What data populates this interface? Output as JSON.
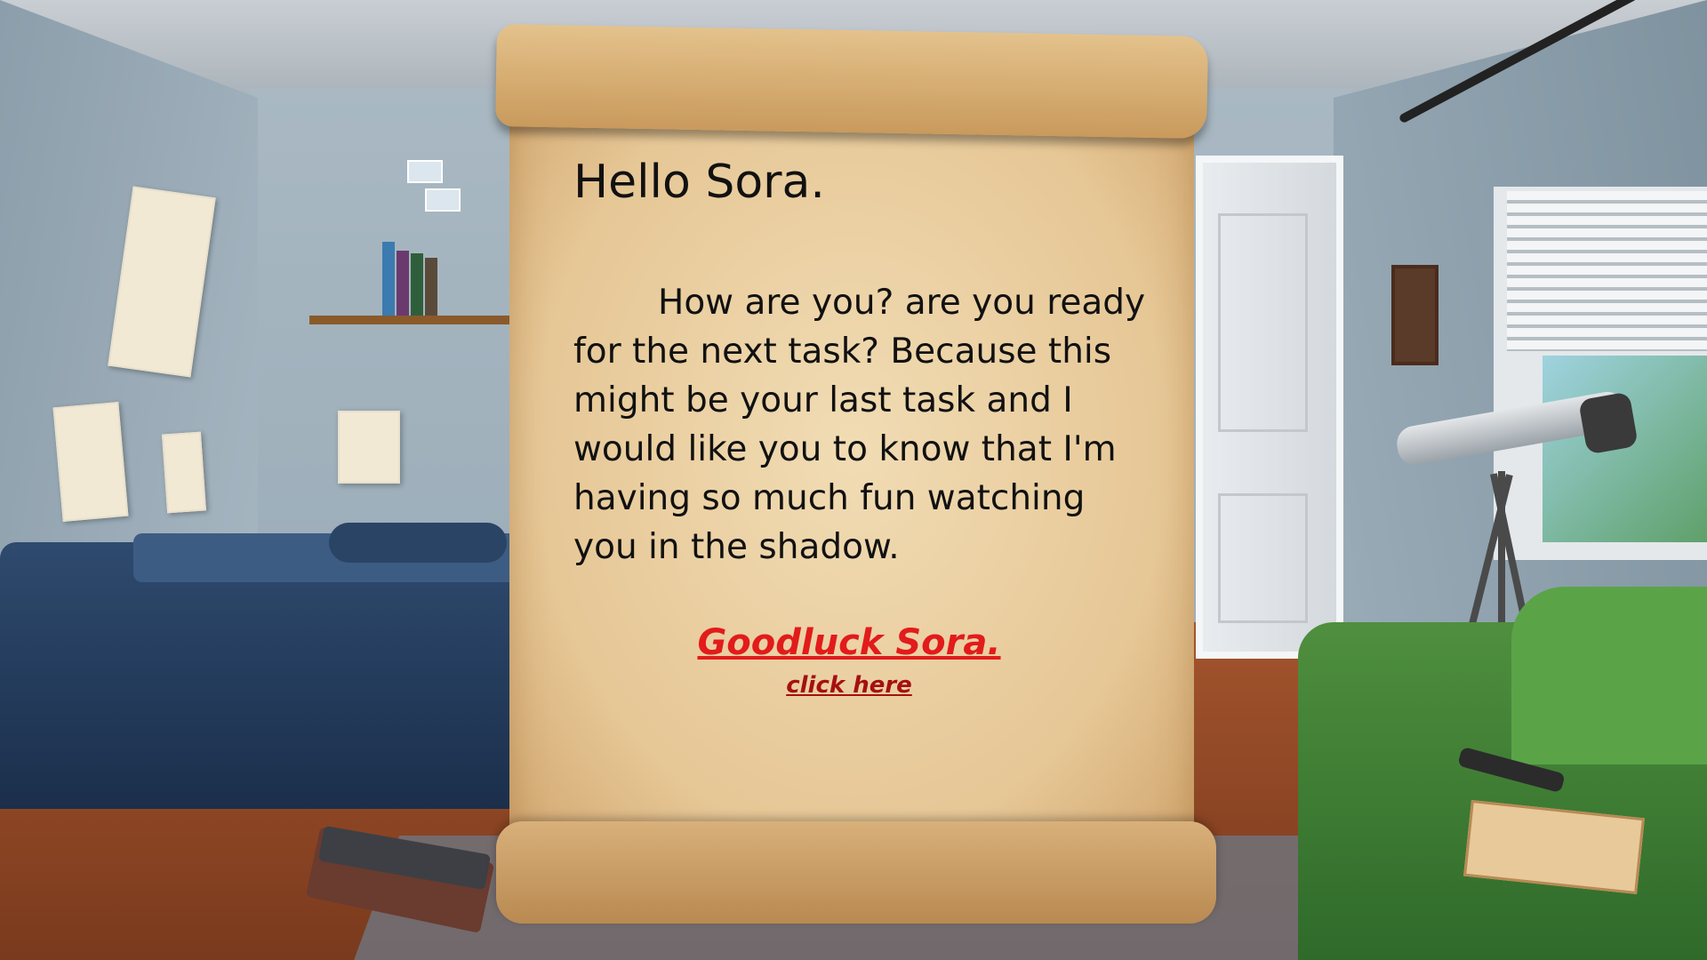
{
  "letter": {
    "greeting": "Hello Sora.",
    "message": "How are you? are you ready for the next task? Because this might be your last task and I would like you to know that I'm having so much fun watching you in the shadow.",
    "closing": "Goodluck Sora.",
    "link_label": "click here"
  },
  "colors": {
    "closing": "#e21b1b",
    "link": "#a51010",
    "paper": "#ecd3a8"
  }
}
